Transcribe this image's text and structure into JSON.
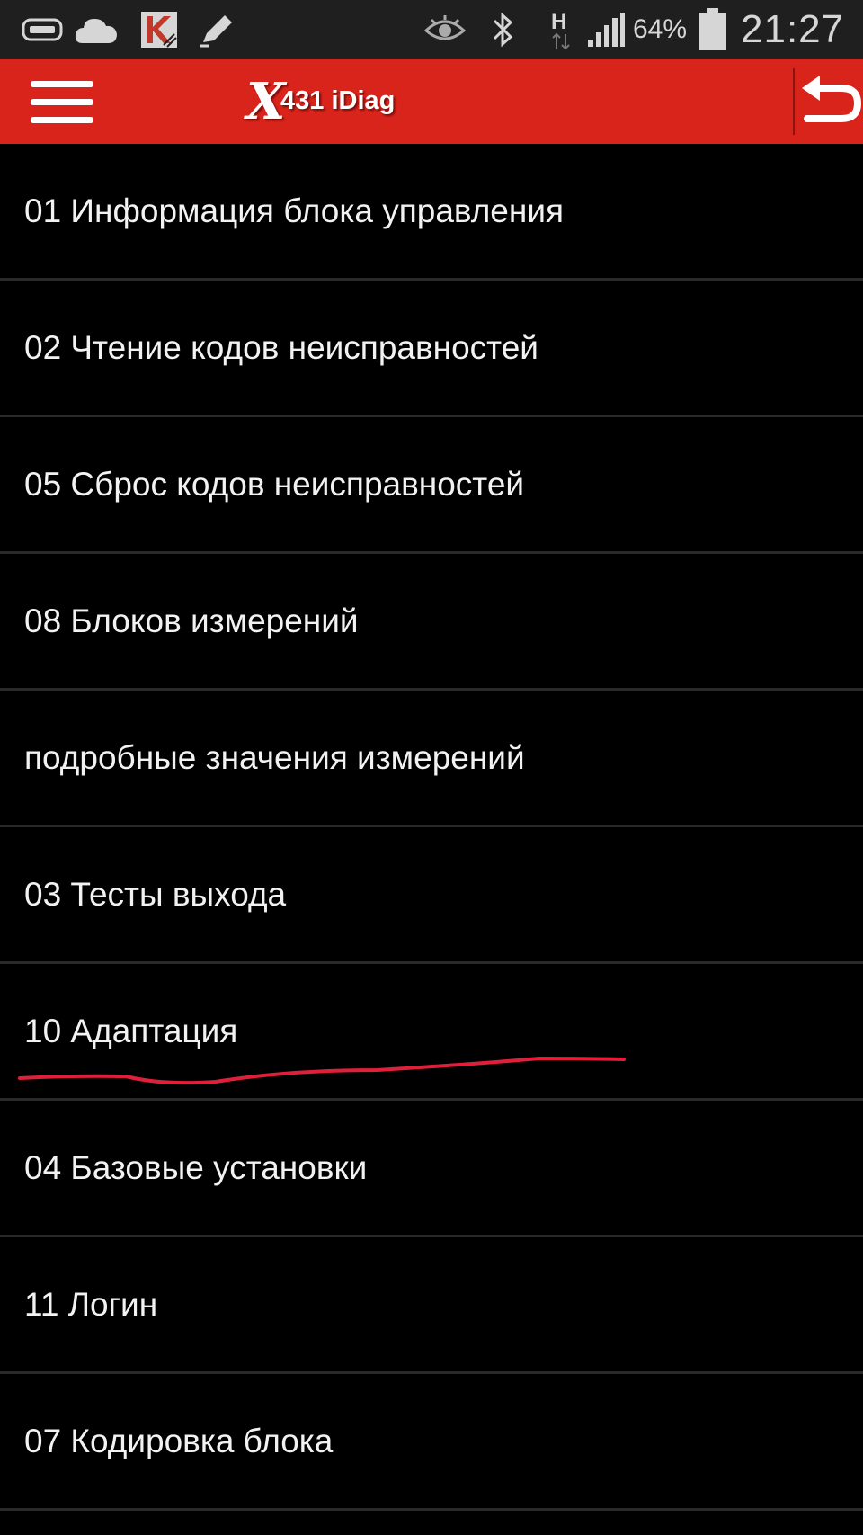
{
  "status_bar": {
    "battery_percent": "64%",
    "time": "21:27",
    "network_type": "H",
    "icons": [
      "tablet-icon",
      "cloud-icon",
      "kaspersky-icon",
      "pencil-icon",
      "eye-icon",
      "bluetooth-icon",
      "network-h-icon",
      "signal-icon",
      "battery-icon"
    ]
  },
  "app_bar": {
    "logo_x": "X",
    "logo_text": "431 iDiag",
    "background_color": "#d9241b"
  },
  "menu": {
    "items": [
      {
        "label": "01 Информация блока управления"
      },
      {
        "label": "02 Чтение кодов неисправностей"
      },
      {
        "label": "05 Сброс кодов неисправностей"
      },
      {
        "label": "08 Блоков измерений"
      },
      {
        "label": "подробные значения измерений"
      },
      {
        "label": "03 Тесты выхода"
      },
      {
        "label": "10 Адаптация"
      },
      {
        "label": "04 Базовые установки"
      },
      {
        "label": "11 Логин"
      },
      {
        "label": "07 Кодировка блока"
      }
    ]
  },
  "annotation": {
    "underline_color": "#e0203a"
  }
}
